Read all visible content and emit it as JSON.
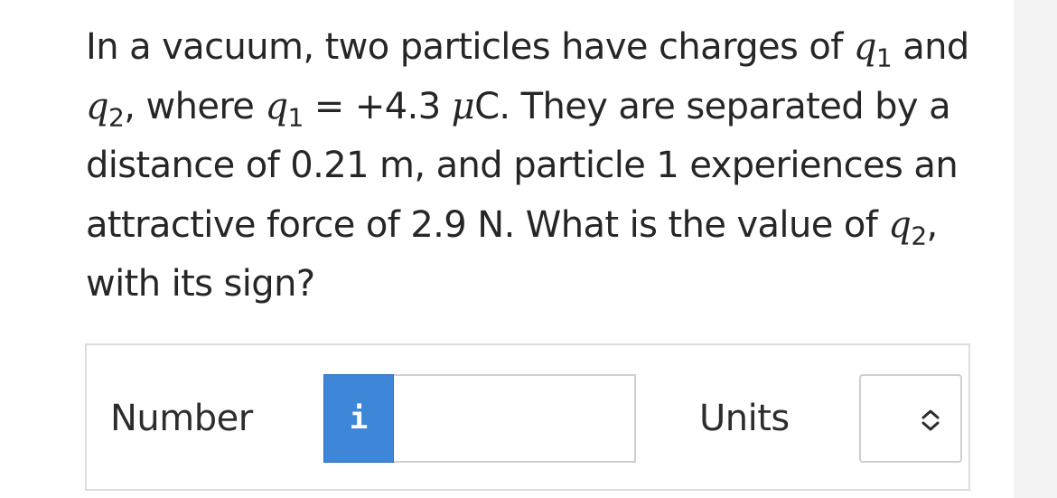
{
  "question": {
    "part1": "In a vacuum, two particles have charges of ",
    "q_symbol": "q",
    "q1_sub": "1",
    "part2": " and ",
    "q2_sub": "2",
    "part3": ", where ",
    "part4": " = +4.3 ",
    "mu_symbol": "μ",
    "part5": "C. They are separated by a distance of 0.21 m, and particle 1 experiences an attractive force of 2.9 N. What is the value of ",
    "part6": ", with its sign?"
  },
  "answer": {
    "number_label": "Number",
    "info_icon_text": "i",
    "number_value": "",
    "units_label": "Units",
    "units_value": ""
  },
  "colors": {
    "info_button": "#3d86d8",
    "border": "#dcdcdc"
  },
  "icons": {
    "info": "info-icon",
    "select_arrows": "up-down-chevron-icon"
  }
}
